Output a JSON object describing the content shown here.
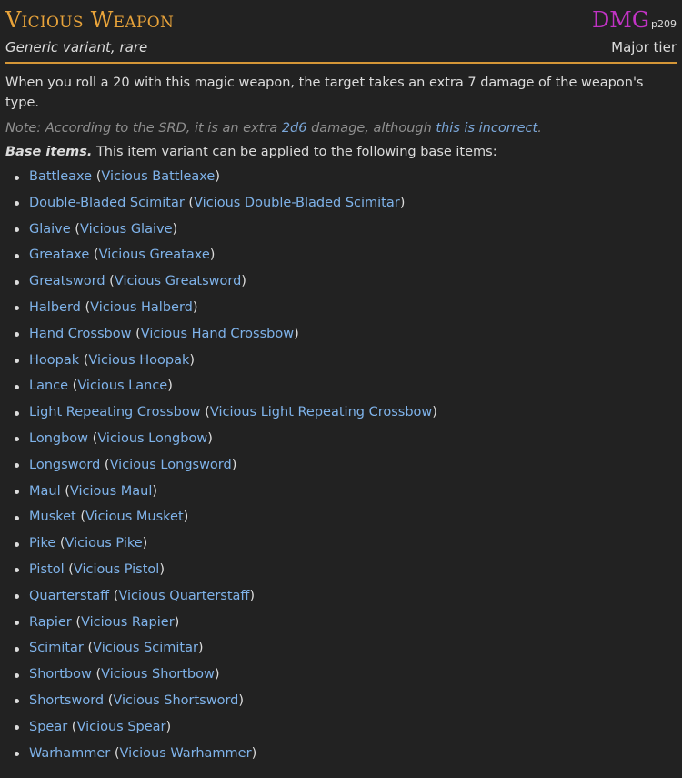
{
  "item": {
    "title": "Vicious Weapon",
    "subtitle": "Generic variant, rare",
    "source_abbr": "DMG",
    "source_page": "p209",
    "tier": "Major tier"
  },
  "description": "When you roll a 20 with this magic weapon, the target takes an extra 7 damage of the weapon's type.",
  "note": {
    "prefix": "Note: According to the SRD, it is an extra ",
    "dice_link": "2d6",
    "middle": " damage, although ",
    "link": "this is incorrect",
    "suffix": "."
  },
  "base_items": {
    "label": "Base items.",
    "intro": " This item variant can be applied to the following base items:",
    "items": [
      {
        "base": "Battleaxe",
        "variant": "Vicious Battleaxe"
      },
      {
        "base": "Double-Bladed Scimitar",
        "variant": "Vicious Double-Bladed Scimitar"
      },
      {
        "base": "Glaive",
        "variant": "Vicious Glaive"
      },
      {
        "base": "Greataxe",
        "variant": "Vicious Greataxe"
      },
      {
        "base": "Greatsword",
        "variant": "Vicious Greatsword"
      },
      {
        "base": "Halberd",
        "variant": "Vicious Halberd"
      },
      {
        "base": "Hand Crossbow",
        "variant": "Vicious Hand Crossbow"
      },
      {
        "base": "Hoopak",
        "variant": "Vicious Hoopak"
      },
      {
        "base": "Lance",
        "variant": "Vicious Lance"
      },
      {
        "base": "Light Repeating Crossbow",
        "variant": "Vicious Light Repeating Crossbow"
      },
      {
        "base": "Longbow",
        "variant": "Vicious Longbow"
      },
      {
        "base": "Longsword",
        "variant": "Vicious Longsword"
      },
      {
        "base": "Maul",
        "variant": "Vicious Maul"
      },
      {
        "base": "Musket",
        "variant": "Vicious Musket"
      },
      {
        "base": "Pike",
        "variant": "Vicious Pike"
      },
      {
        "base": "Pistol",
        "variant": "Vicious Pistol"
      },
      {
        "base": "Quarterstaff",
        "variant": "Vicious Quarterstaff"
      },
      {
        "base": "Rapier",
        "variant": "Vicious Rapier"
      },
      {
        "base": "Scimitar",
        "variant": "Vicious Scimitar"
      },
      {
        "base": "Shortbow",
        "variant": "Vicious Shortbow"
      },
      {
        "base": "Shortsword",
        "variant": "Vicious Shortsword"
      },
      {
        "base": "Spear",
        "variant": "Vicious Spear"
      },
      {
        "base": "Warhammer",
        "variant": "Vicious Warhammer"
      }
    ]
  },
  "colors": {
    "background": "#222222",
    "title": "#e8a33a",
    "source": "#c133c4",
    "link": "#7fb3ea",
    "note": "#8f8f8f"
  }
}
